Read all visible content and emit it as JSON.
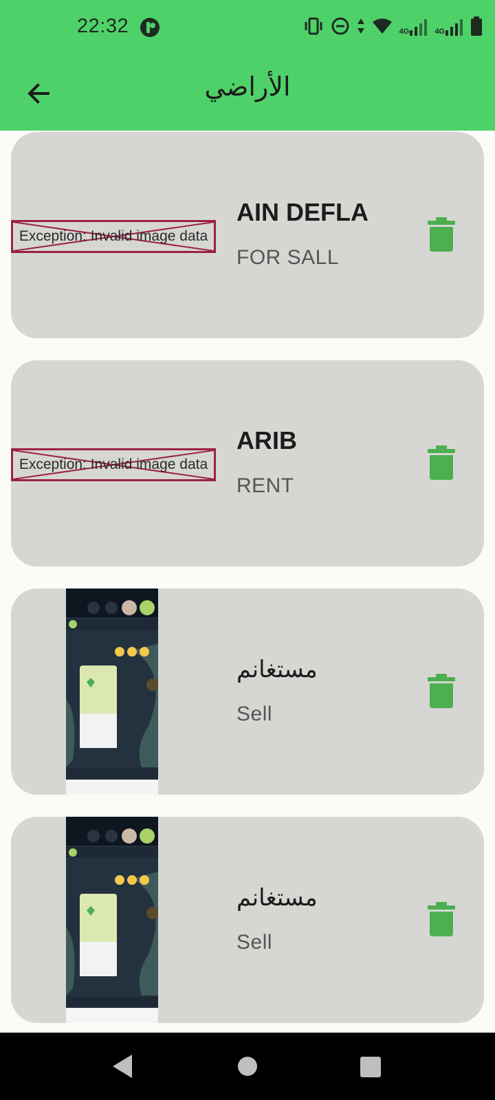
{
  "status_bar": {
    "time": "22:32",
    "network_label_1": "4G",
    "network_label_2": "4G"
  },
  "app_bar": {
    "title": "الأراضي",
    "back_icon": "arrow-back-icon"
  },
  "lands": [
    {
      "title": "AIN DEFLA",
      "subtitle": "FOR SALL",
      "image_error": "Exception: Invalid image data"
    },
    {
      "title": "ARIB",
      "subtitle": "RENT",
      "image_error": "Exception: Invalid image data"
    },
    {
      "title": "مستغانم",
      "subtitle": "Sell"
    },
    {
      "title": "مستغانم",
      "subtitle": "Sell"
    }
  ],
  "colors": {
    "app_bar": "#4fd16a",
    "card": "#d6d7d3",
    "delete_icon": "#4caf50",
    "error_border": "#9b2145"
  }
}
